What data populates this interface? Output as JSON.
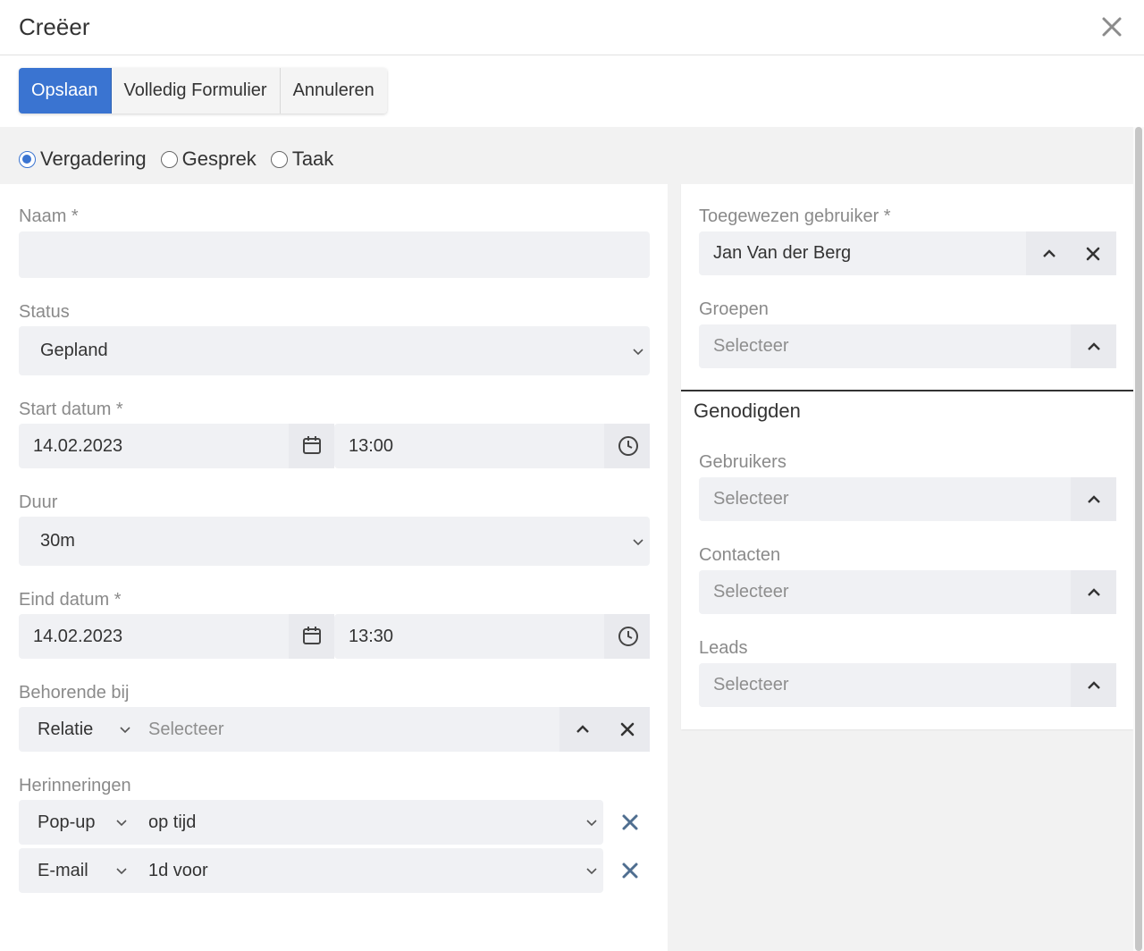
{
  "dialog": {
    "title": "Creëer"
  },
  "toolbar": {
    "save_label": "Opslaan",
    "full_form_label": "Volledig Formulier",
    "cancel_label": "Annuleren"
  },
  "types": [
    {
      "label": "Vergadering",
      "checked": true
    },
    {
      "label": "Gesprek",
      "checked": false
    },
    {
      "label": "Taak",
      "checked": false
    }
  ],
  "form": {
    "name": {
      "label": "Naam *",
      "value": ""
    },
    "status": {
      "label": "Status",
      "value": "Gepland"
    },
    "start": {
      "label": "Start datum *",
      "date": "14.02.2023",
      "time": "13:00"
    },
    "duration": {
      "label": "Duur",
      "value": "30m"
    },
    "end": {
      "label": "Eind datum *",
      "date": "14.02.2023",
      "time": "13:30"
    },
    "parent": {
      "label": "Behorende bij",
      "type": "Relatie",
      "placeholder": "Selecteer"
    },
    "reminders": {
      "label": "Herinneringen",
      "items": [
        {
          "type": "Pop-up",
          "when": "op tijd"
        },
        {
          "type": "E-mail",
          "when": "1d voor"
        }
      ]
    }
  },
  "side": {
    "assigned_user": {
      "label": "Toegewezen gebruiker *",
      "value": "Jan Van der Berg"
    },
    "teams": {
      "label": "Groepen",
      "placeholder": "Selecteer"
    },
    "attendees_title": "Genodigden",
    "users": {
      "label": "Gebruikers",
      "placeholder": "Selecteer"
    },
    "contacts": {
      "label": "Contacten",
      "placeholder": "Selecteer"
    },
    "leads": {
      "label": "Leads",
      "placeholder": "Selecteer"
    }
  },
  "colors": {
    "primary": "#3a74d1",
    "field_bg": "#f0f1f4",
    "remove_icon": "#4f6e90"
  }
}
